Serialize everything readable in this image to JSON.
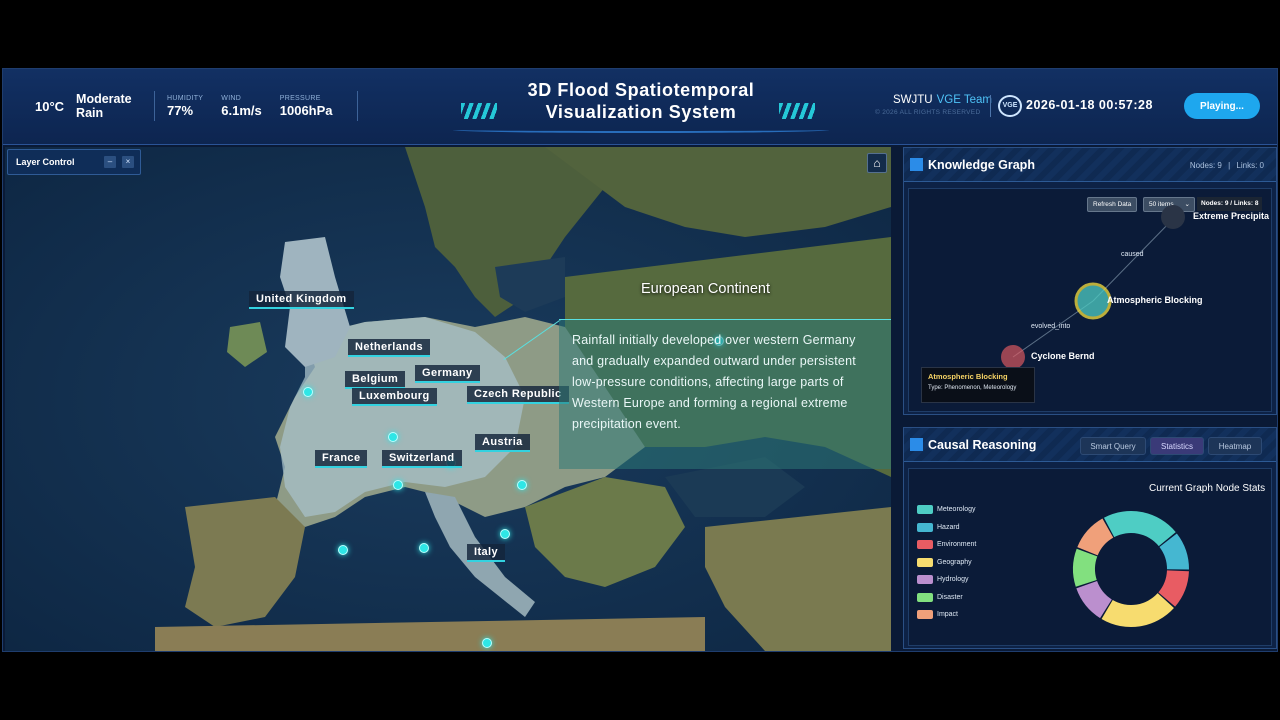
{
  "header": {
    "temperature": "10°C",
    "condition": "Moderate Rain",
    "metrics": [
      {
        "label": "HUMIDITY",
        "value": "77%"
      },
      {
        "label": "WIND",
        "value": "6.1m/s"
      },
      {
        "label": "PRESSURE",
        "value": "1006hPa"
      }
    ],
    "title_line1": "3D Flood Spatiotemporal",
    "title_line2": "Visualization System",
    "team": "SWJTU",
    "team_accent": "VGE Team",
    "rights": "© 2026 ALL RIGHTS RESERVED",
    "logo_text": "VGE",
    "datetime": "2026-01-18 00:57:28",
    "play_label": "Playing..."
  },
  "map": {
    "layer_control": {
      "label": "Layer Control",
      "minimize": "–",
      "close": "×"
    },
    "home_icon": "home-icon",
    "continent_label": "European Continent",
    "countries": [
      {
        "name": "United Kingdom"
      },
      {
        "name": "Netherlands"
      },
      {
        "name": "Belgium"
      },
      {
        "name": "Germany"
      },
      {
        "name": "Luxembourg"
      },
      {
        "name": "Czech Republic"
      },
      {
        "name": "Austria"
      },
      {
        "name": "France"
      },
      {
        "name": "Switzerland"
      },
      {
        "name": "Italy"
      }
    ],
    "story": "Rainfall initially developed over western Germany and gradually expanded outward under persistent low-pressure conditions, affecting large parts of Western Europe and forming a regional extreme precipitation event."
  },
  "knowledge_graph": {
    "title": "Knowledge Graph",
    "nodes_count": "Nodes: 9",
    "links_count": "Links: 0",
    "refresh_label": "Refresh Data",
    "items_select": "50 items",
    "stat_badge": "Nodes: 9 / Links: 8",
    "node_labels": [
      "Extreme Precipita",
      "Atmospheric Blocking",
      "Cyclone Bernd"
    ],
    "edge_labels": [
      "caused",
      "evolved_into"
    ],
    "tooltip": {
      "title": "Atmospheric Blocking",
      "type": "Type: Phenomenon, Meteorology"
    }
  },
  "causal_reasoning": {
    "title": "Causal Reasoning",
    "tabs": [
      "Smart Query",
      "Statistics",
      "Heatmap"
    ],
    "active_tab": "Statistics",
    "stats_title": "Current Graph Node Stats"
  },
  "chart_data": {
    "type": "pie",
    "title": "Current Graph Node Stats",
    "categories": [
      "Meteorology",
      "Hazard",
      "Environment",
      "Geography",
      "Hydrology",
      "Disaster",
      "Impact"
    ],
    "values": [
      2,
      1,
      1,
      2,
      1,
      1,
      1
    ],
    "colors": [
      "#4ecdc4",
      "#45b7d1",
      "#e85c63",
      "#f7dc6f",
      "#bb8fce",
      "#82e07f",
      "#f0a07a"
    ],
    "legend_position": "left"
  }
}
